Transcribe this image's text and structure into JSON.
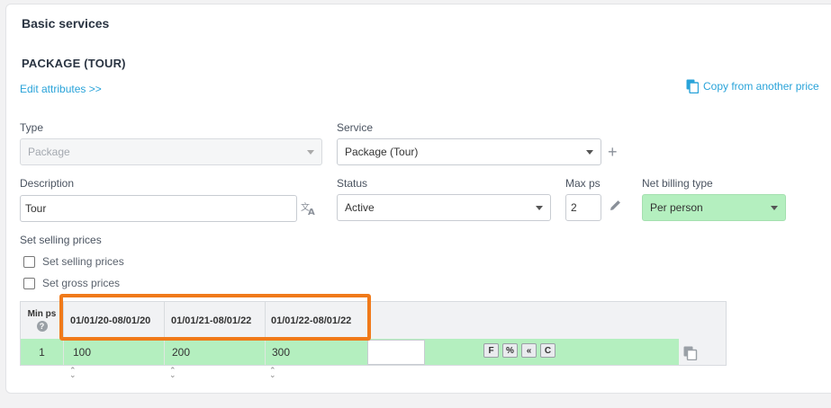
{
  "section": {
    "title": "Basic services",
    "subtitle": "PACKAGE (TOUR)"
  },
  "links": {
    "edit_attributes": "Edit attributes >>",
    "copy_from": "Copy from another price"
  },
  "form": {
    "type": {
      "label": "Type",
      "value": "Package"
    },
    "service": {
      "label": "Service",
      "value": "Package (Tour)"
    },
    "description": {
      "label": "Description",
      "value": "Tour"
    },
    "status": {
      "label": "Status",
      "value": "Active"
    },
    "max_ps": {
      "label": "Max ps",
      "value": "2"
    },
    "net_billing_type": {
      "label": "Net billing type",
      "value": "Per person"
    },
    "set_selling_prices_label": "Set selling prices",
    "checkboxes": [
      {
        "label": "Set selling prices",
        "checked": false
      },
      {
        "label": "Set gross prices",
        "checked": false
      }
    ]
  },
  "price_grid": {
    "min_ps_header": "Min ps",
    "help_icon_text": "?",
    "columns": [
      "01/01/20-08/01/20",
      "01/01/21-08/01/22",
      "01/01/22-08/01/22"
    ],
    "rows": [
      {
        "min_ps": "1",
        "values": [
          "100",
          "200",
          "300"
        ],
        "new_value": ""
      }
    ],
    "tools": [
      "F",
      "%",
      "«",
      "C"
    ]
  },
  "colors": {
    "accent_link": "#29a3d9",
    "row_green": "#b4efbf",
    "highlight_orange": "#f07a1a"
  }
}
